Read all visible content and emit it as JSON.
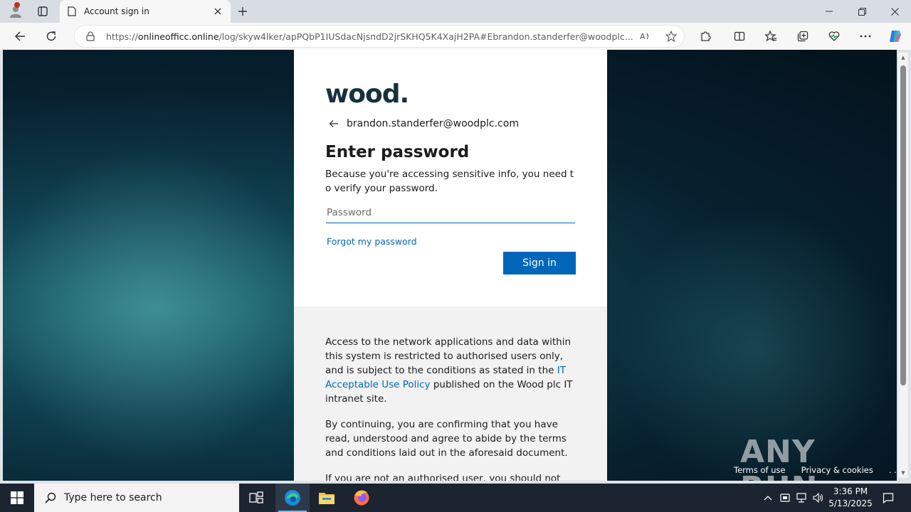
{
  "browser": {
    "tab_title": "Account sign in",
    "url_prefix": "https://",
    "url_domain": "onlineofficc.online",
    "url_rest": "/log/skyw4lker/apPQbP1IUSdacNjsndD2jrSKHQ5K4XajH2PA#Ebrandon.standerfer@woodplc...."
  },
  "icons": {
    "profile": "profile-icon",
    "tab_actions": "tab-actions-icon",
    "page": "page-icon",
    "close": "close-icon",
    "new_tab": "plus-icon",
    "minimize": "minimize-icon",
    "restore": "restore-icon",
    "window_close": "close-icon",
    "back": "back-arrow-icon",
    "refresh": "refresh-icon",
    "lock": "lock-icon",
    "read_aloud": "read-aloud-icon",
    "favorite": "star-icon",
    "extensions": "puzzle-icon",
    "split": "split-screen-icon",
    "favorites": "favorites-icon",
    "collections": "collections-icon",
    "performance": "heart-pulse-icon",
    "more": "more-icon",
    "copilot": "copilot-icon"
  },
  "signin": {
    "logo": "wood.",
    "identity": "brandon.standerfer@woodplc.com",
    "heading": "Enter password",
    "description": "Because you're accessing sensitive info, you need to verify your password.",
    "password_placeholder": "Password",
    "forgot_link": "Forgot my password",
    "signin_button": "Sign in"
  },
  "notice": {
    "para1_before": "Access to the network applications and data within this system is restricted to authorised users only, and is subject to the conditions as stated in the ",
    "para1_link": "IT Acceptable Use Policy",
    "para1_after": " published on the Wood plc IT intranet site.",
    "para2": "By continuing, you are confirming that you have read, understood and agree to abide by the terms and conditions laid out in the aforesaid document.",
    "para3": "If you are not an authorised user, you should not"
  },
  "footer": {
    "terms": "Terms of use",
    "privacy": "Privacy & cookies",
    "more": ". . ."
  },
  "watermark": "ANY RUN",
  "taskbar": {
    "search_placeholder": "Type here to search",
    "time": "3:36 PM",
    "date": "5/13/2025"
  },
  "colors": {
    "accent": "#0067b8",
    "logo": "#16313d",
    "taskbar": "#1b2430"
  }
}
